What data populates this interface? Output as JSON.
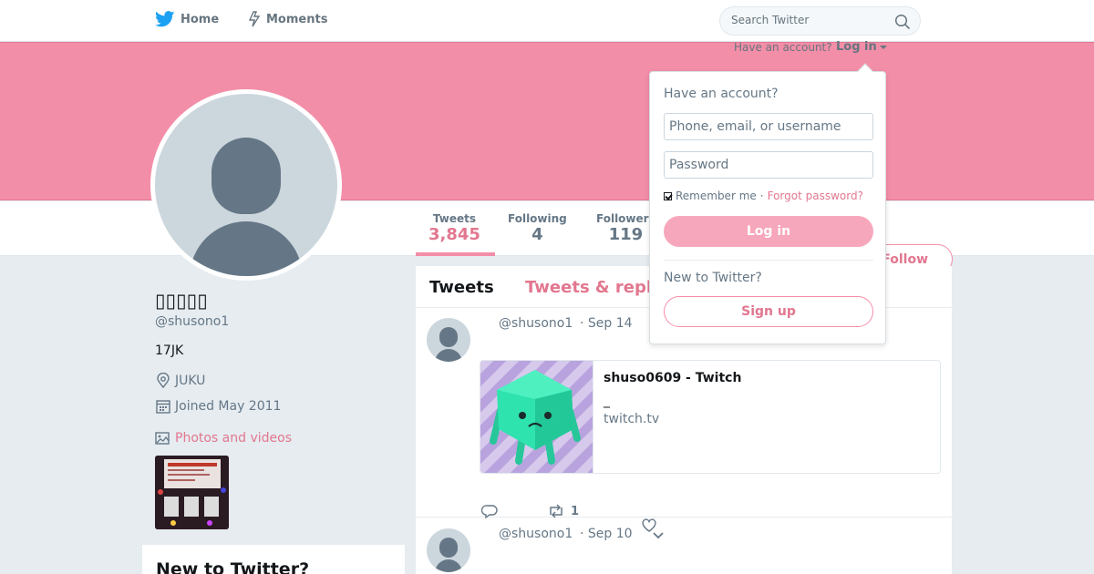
{
  "nav": {
    "home_label": "Home",
    "moments_label": "Moments",
    "search_placeholder": "Search Twitter"
  },
  "banner": {
    "have_account": "Have an account?",
    "login_label": "Log in"
  },
  "stats": {
    "tweets_label": "Tweets",
    "tweets_value": "3,845",
    "following_label": "Following",
    "following_value": "4",
    "followers_label": "Followers",
    "followers_value": "119"
  },
  "follow_label": "Follow",
  "profile": {
    "name": "▯▯▯▯▯",
    "handle": "@shusono1",
    "bio": "17JK",
    "location": "JUKU",
    "joined": "Joined May 2011",
    "photos_label": "Photos and videos"
  },
  "timeline": {
    "tab_tweets": "Tweets",
    "tab_replies": "Tweets & replies",
    "tweets": [
      {
        "handle": "@shusono1",
        "date": "· Sep 14",
        "card_title": "shuso0609 - Twitch",
        "card_desc": "_",
        "card_domain": "twitch.tv",
        "retweets": "1"
      },
      {
        "handle": "@shusono1",
        "date": "· Sep 10"
      }
    ]
  },
  "new_to_twitter_panel": "New to Twitter?",
  "login_dropdown": {
    "title": "Have an account?",
    "username_placeholder": "Phone, email, or username",
    "password_placeholder": "Password",
    "remember_label": "Remember me",
    "separator": "·",
    "forgot_label": "Forgot password?",
    "login_button": "Log in",
    "new_label": "New to Twitter?",
    "signup_button": "Sign up"
  },
  "colors": {
    "accent": "#f38ea8",
    "accent_text": "#e2778f",
    "twitter_blue": "#1da1f2"
  }
}
